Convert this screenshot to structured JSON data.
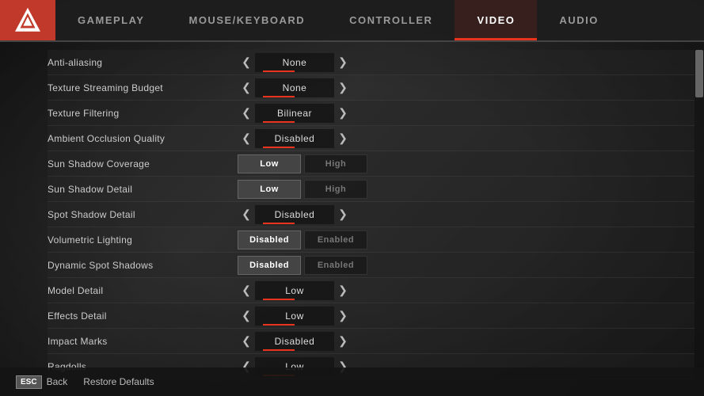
{
  "logo": {
    "alt": "Apex Legends"
  },
  "nav": {
    "tabs": [
      {
        "id": "gameplay",
        "label": "GAMEPLAY",
        "active": false
      },
      {
        "id": "mouse-keyboard",
        "label": "MOUSE/KEYBOARD",
        "active": false
      },
      {
        "id": "controller",
        "label": "CONTROLLER",
        "active": false
      },
      {
        "id": "video",
        "label": "VIDEO",
        "active": true
      },
      {
        "id": "audio",
        "label": "AUDIO",
        "active": false
      }
    ]
  },
  "settings": {
    "rows": [
      {
        "label": "Anti-aliasing",
        "type": "arrow",
        "value": "None"
      },
      {
        "label": "Texture Streaming Budget",
        "type": "arrow",
        "value": "None"
      },
      {
        "label": "Texture Filtering",
        "type": "arrow",
        "value": "Bilinear"
      },
      {
        "label": "Ambient Occlusion Quality",
        "type": "arrow",
        "value": "Disabled"
      },
      {
        "label": "Sun Shadow Coverage",
        "type": "toggle2",
        "option1": "Low",
        "option2": "High",
        "active": "option1"
      },
      {
        "label": "Sun Shadow Detail",
        "type": "toggle2",
        "option1": "Low",
        "option2": "High",
        "active": "option1"
      },
      {
        "label": "Spot Shadow Detail",
        "type": "arrow",
        "value": "Disabled"
      },
      {
        "label": "Volumetric Lighting",
        "type": "toggle2",
        "option1": "Disabled",
        "option2": "Enabled",
        "active": "option1"
      },
      {
        "label": "Dynamic Spot Shadows",
        "type": "toggle2",
        "option1": "Disabled",
        "option2": "Enabled",
        "active": "option1"
      },
      {
        "label": "Model Detail",
        "type": "arrow",
        "value": "Low"
      },
      {
        "label": "Effects Detail",
        "type": "arrow",
        "value": "Low"
      },
      {
        "label": "Impact Marks",
        "type": "arrow",
        "value": "Disabled"
      },
      {
        "label": "Ragdolls",
        "type": "arrow",
        "value": "Low"
      }
    ]
  },
  "footer": {
    "back_key": "ESC",
    "back_label": "Back",
    "restore_label": "Restore Defaults"
  }
}
